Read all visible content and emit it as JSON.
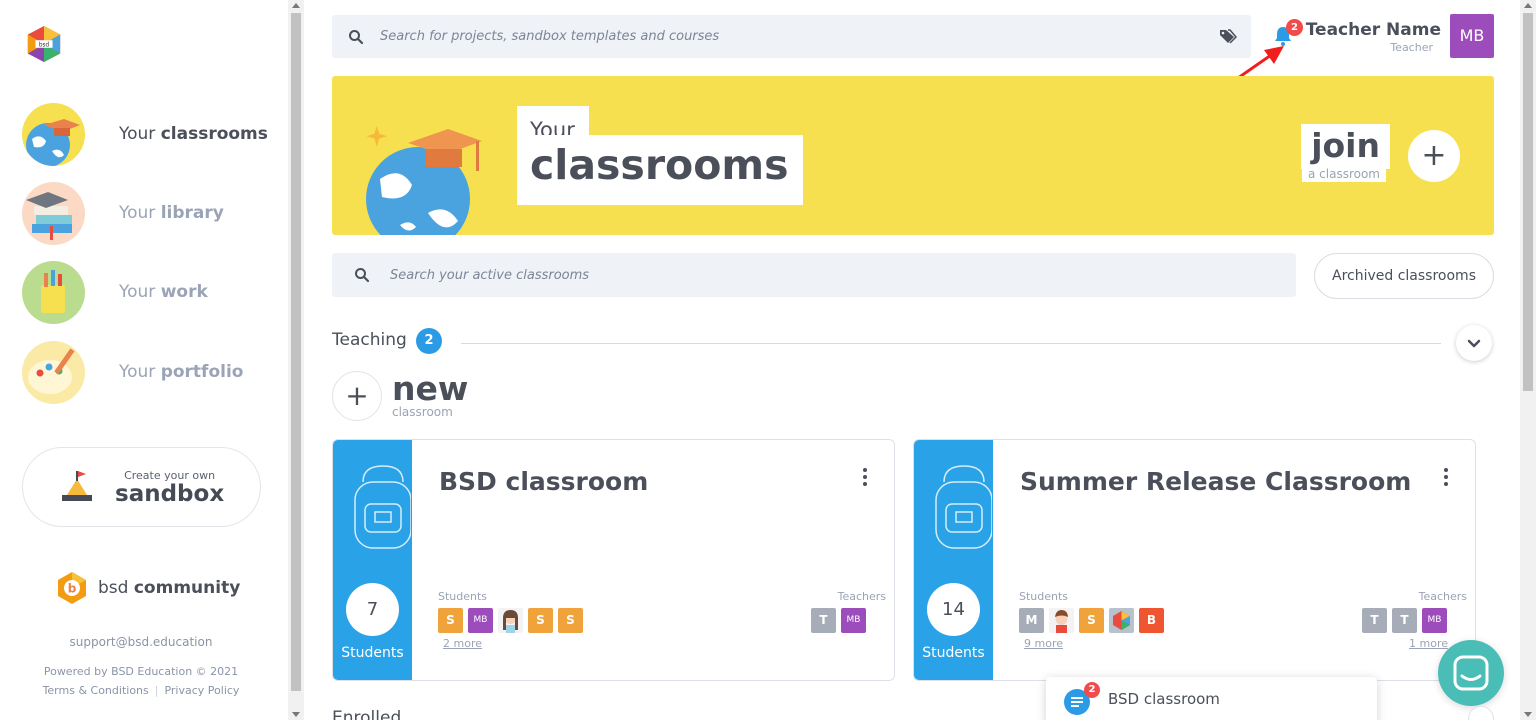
{
  "sidebar": {
    "logo_text": "bsd",
    "items": [
      {
        "prefix": "Your",
        "bold": "classrooms",
        "icon": "classrooms-globe-icon"
      },
      {
        "prefix": "Your",
        "bold": "library",
        "icon": "library-books-icon"
      },
      {
        "prefix": "Your",
        "bold": "work",
        "icon": "work-pencils-icon"
      },
      {
        "prefix": "Your",
        "bold": "portfolio",
        "icon": "portfolio-palette-icon"
      }
    ],
    "sandbox": {
      "small": "Create your own",
      "big": "sandbox"
    },
    "community": {
      "prefix": "bsd",
      "bold": "community"
    },
    "support_email": "support@bsd.education",
    "powered_by": "Powered by BSD Education © 2021",
    "terms": "Terms & Conditions",
    "privacy": "Privacy Policy",
    "legal_separator": "|"
  },
  "header": {
    "search_placeholder": "Search for projects, sandbox templates and courses",
    "notification_count": "2",
    "user_name": "Teacher Name",
    "user_role": "Teacher",
    "user_initials": "MB"
  },
  "banner": {
    "your": "Your",
    "classrooms": "classrooms",
    "join_big": "join",
    "join_small": "a classroom",
    "plus": "+"
  },
  "classroom_search": {
    "placeholder": "Search your active classrooms",
    "archived_label": "Archived classrooms"
  },
  "teaching": {
    "title": "Teaching",
    "count": "2",
    "new_plus": "+",
    "new_big": "new",
    "new_small": "classroom"
  },
  "cards": [
    {
      "title": "BSD classroom",
      "student_count": "7",
      "count_label": "Students",
      "students_label": "Students",
      "teachers_label": "Teachers",
      "students": [
        {
          "text": "S",
          "color": "#f0a33a"
        },
        {
          "text": "MB",
          "color": "#9c4dbb"
        },
        {
          "text": "",
          "color": "#f3f3f3",
          "icon": "girl-avatar-icon"
        },
        {
          "text": "S",
          "color": "#f0a33a"
        },
        {
          "text": "S",
          "color": "#f0a33a"
        }
      ],
      "teachers": [
        {
          "text": "T",
          "color": "#a6adb8"
        },
        {
          "text": "MB",
          "color": "#9c4dbb"
        }
      ],
      "students_more": "2 more",
      "teachers_more": ""
    },
    {
      "title": "Summer Release Classroom",
      "student_count": "14",
      "count_label": "Students",
      "students_label": "Students",
      "teachers_label": "Teachers",
      "students": [
        {
          "text": "M",
          "color": "#a6adb8"
        },
        {
          "text": "",
          "color": "#f3f3f3",
          "icon": "boy-avatar-icon"
        },
        {
          "text": "S",
          "color": "#f0a33a"
        },
        {
          "text": "",
          "color": "#b7c2cc",
          "icon": "bsd-logo-avatar-icon"
        },
        {
          "text": "B",
          "color": "#ee5530"
        }
      ],
      "teachers": [
        {
          "text": "T",
          "color": "#a6adb8"
        },
        {
          "text": "T",
          "color": "#a6adb8"
        },
        {
          "text": "MB",
          "color": "#9c4dbb"
        }
      ],
      "students_more": "9 more",
      "teachers_more": "1 more"
    }
  ],
  "enrolled": {
    "title": "Enrolled"
  },
  "toast": {
    "text": "BSD classroom",
    "badge": "2"
  },
  "colors": {
    "accent_blue": "#2aa2e8",
    "banner_yellow": "#f6e04f",
    "badge_red": "#f24b4b",
    "chat_teal": "#49bdb6"
  }
}
